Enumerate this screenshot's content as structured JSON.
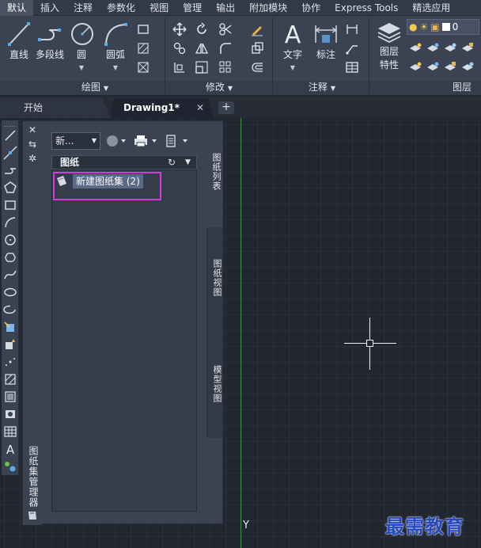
{
  "ribbon_tabs": [
    {
      "label": "默认",
      "active": true
    },
    {
      "label": "插入"
    },
    {
      "label": "注释"
    },
    {
      "label": "参数化"
    },
    {
      "label": "视图"
    },
    {
      "label": "管理"
    },
    {
      "label": "输出"
    },
    {
      "label": "附加模块"
    },
    {
      "label": "协作"
    },
    {
      "label": "Express Tools"
    },
    {
      "label": "精选应用"
    }
  ],
  "draw_panel": {
    "title": "绘图",
    "tools": {
      "line": "直线",
      "polyline": "多段线",
      "circle": "圆",
      "arc": "圆弧"
    }
  },
  "modify_panel": {
    "title": "修改"
  },
  "annotation_panel": {
    "title": "注释",
    "tools": {
      "text": "文字",
      "dimension": "标注"
    }
  },
  "layers_panel": {
    "title": "图层",
    "properties_line1": "图层",
    "properties_line2": "特性",
    "layer_value": "0"
  },
  "file_tabs": {
    "start": "开始",
    "drawing": "Drawing1*",
    "close": "✕",
    "add": "+"
  },
  "sheet_set_manager": {
    "title": "图纸集管理器",
    "dropdown_value": "新...",
    "sheets_header": "图纸",
    "tree_item": "新建图纸集 (2)",
    "side_tabs": [
      "图纸列表",
      "图纸视图",
      "模型视图"
    ]
  },
  "drawing": {
    "y_axis_label": "Y"
  },
  "watermark": "最需教育",
  "colors": {
    "ribbon_bg": "#3b4353",
    "canvas_bg": "#212630",
    "highlight": "#d43ad7",
    "y_axis": "#3f8f3f",
    "watermark": "#2548c0"
  }
}
